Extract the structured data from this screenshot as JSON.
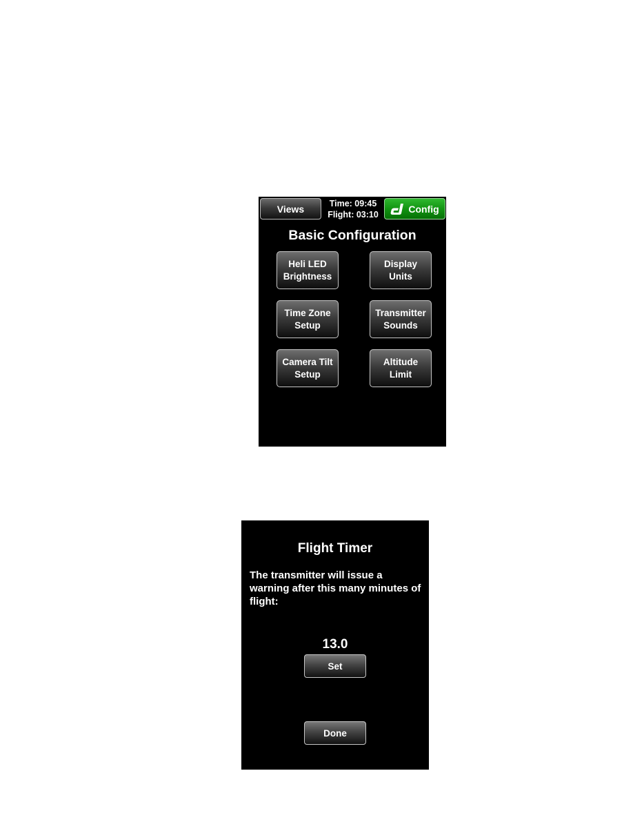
{
  "basic_config_screen": {
    "views_button": "Views",
    "time_label": "Time: 09:45",
    "flight_label": "Flight: 03:10",
    "config_button": "Config",
    "config_icon": "brand-logo-icon",
    "title": "Basic Configuration",
    "buttons": [
      {
        "label": "Heli LED\nBrightness"
      },
      {
        "label": "Display\nUnits"
      },
      {
        "label": "Time Zone\nSetup"
      },
      {
        "label": "Transmitter\nSounds"
      },
      {
        "label": "Camera Tilt\nSetup"
      },
      {
        "label": "Altitude\nLimit"
      }
    ],
    "colors": {
      "config_accent": "#129412",
      "background": "#000000"
    }
  },
  "flight_timer_screen": {
    "title": "Flight Timer",
    "description": "The transmitter will issue a warning after this many minutes of flight:",
    "value": "13.0",
    "set_button": "Set",
    "done_button": "Done"
  }
}
